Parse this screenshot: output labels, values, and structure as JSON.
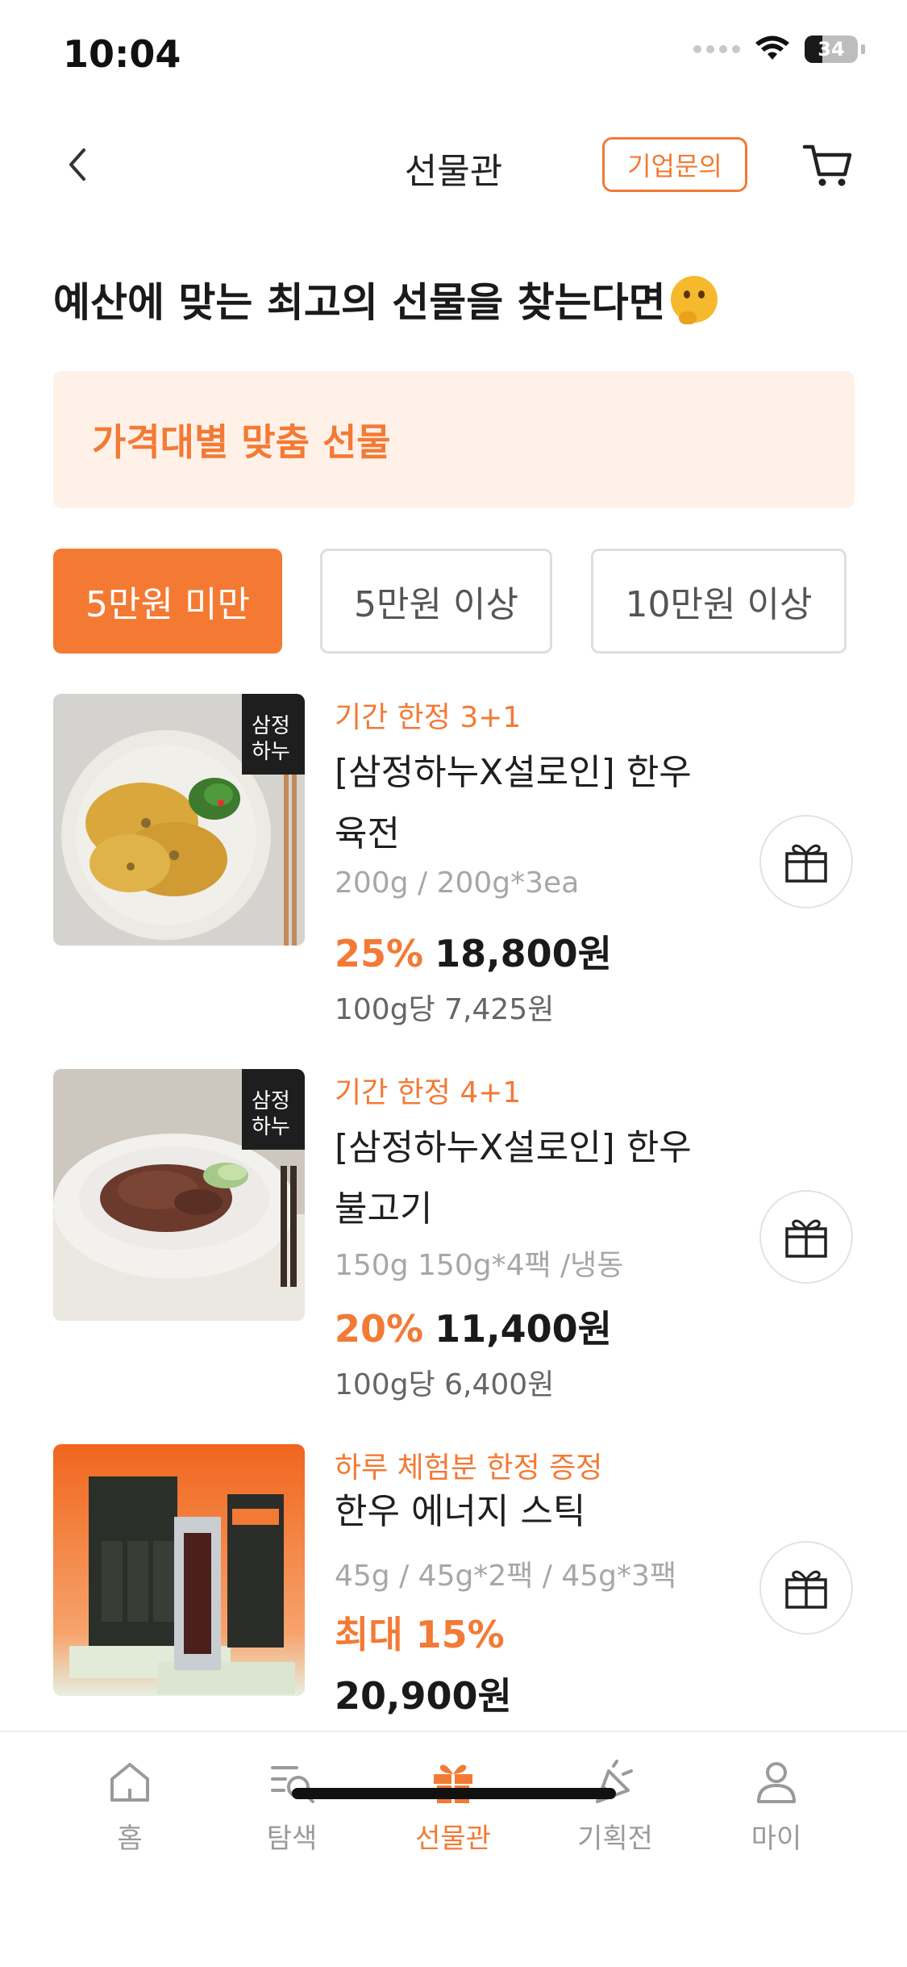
{
  "status_bar": {
    "time": "10:04",
    "battery": "34",
    "battery_level": 0.34
  },
  "header": {
    "title": "선물관",
    "biz_button": "기업문의"
  },
  "heading": "예산에 맞는 최고의 선물을 찾는다면",
  "banner": {
    "label": "가격대별 맞춤 선물"
  },
  "price_tabs": [
    {
      "label": "5만원 미만",
      "active": true
    },
    {
      "label": "5만원 이상",
      "active": false
    },
    {
      "label": "10만원 이상",
      "active": false
    }
  ],
  "products": [
    {
      "promo": "기간 한정 3+1",
      "name_line1": "[삼정하누X설로인] 한우",
      "name_line2": "육전",
      "option": "200g / 200g*3ea",
      "discount": "25%",
      "price": "18,800원",
      "unit_price": "100g당 7,425원",
      "brand_mark": "삼정하누"
    },
    {
      "promo": "기간 한정 4+1",
      "name_line1": "[삼정하누X설로인] 한우",
      "name_line2": "불고기",
      "option": "150g 150g*4팩 /냉동",
      "discount": "20%",
      "price": "11,400원",
      "unit_price": "100g당 6,400원",
      "brand_mark": "삼정하누"
    },
    {
      "promo": "하루 체험분 한정 증정",
      "name": "한우 에너지 스틱",
      "option": "45g / 45g*2팩 / 45g*3팩",
      "discount": "최대 15%",
      "price": "20,900원"
    }
  ],
  "bottom_nav": [
    {
      "label": "홈",
      "icon": "home-icon",
      "active": false
    },
    {
      "label": "탐색",
      "icon": "search-list-icon",
      "active": false
    },
    {
      "label": "선물관",
      "icon": "gift-icon",
      "active": true
    },
    {
      "label": "기획전",
      "icon": "party-icon",
      "active": false
    },
    {
      "label": "마이",
      "icon": "person-icon",
      "active": false
    }
  ],
  "colors": {
    "accent": "#f37a35",
    "banner_bg": "#fff1e8",
    "text": "#222222",
    "muted": "#a7a7a7"
  }
}
